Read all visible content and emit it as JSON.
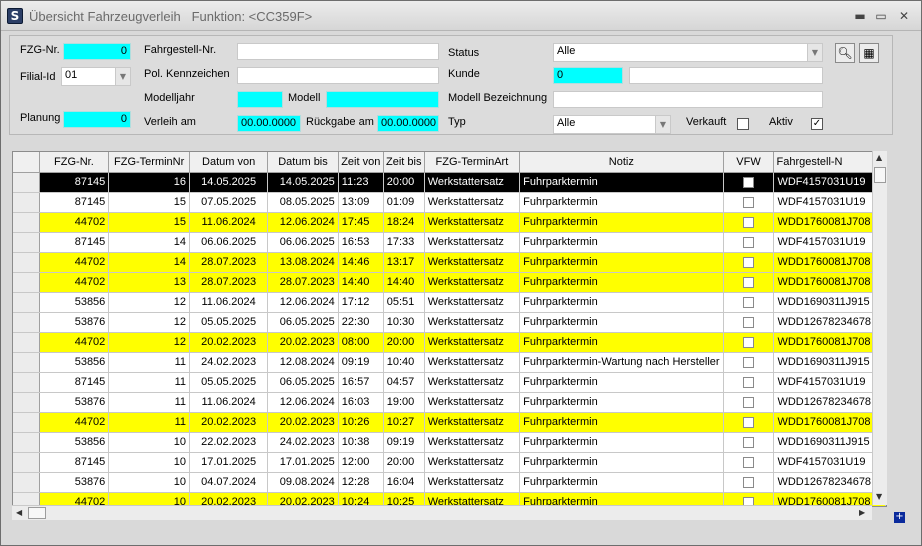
{
  "window": {
    "title": "Übersicht Fahrzeugverleih",
    "function_label": "Funktion: <CC359F>",
    "minimize": "▬",
    "maximize": "▭",
    "close": "✕"
  },
  "filters": {
    "fzg_nr": {
      "label": "FZG-Nr.",
      "value": "0"
    },
    "filial_id": {
      "label": "Filial-Id",
      "value": "01"
    },
    "planung": {
      "label": "Planung",
      "value": "0"
    },
    "fahrgestell_nr": {
      "label": "Fahrgestell-Nr.",
      "value": ""
    },
    "pol_kennzeichen": {
      "label": "Pol. Kennzeichen",
      "value": ""
    },
    "modelljahr": {
      "label": "Modelljahr",
      "value": ""
    },
    "modell": {
      "label": "Modell",
      "value": ""
    },
    "verleih_am": {
      "label": "Verleih am",
      "value": "00.00.0000"
    },
    "rueckgabe_am": {
      "label": "Rückgabe am",
      "value": "00.00.0000"
    },
    "status": {
      "label": "Status",
      "value": "Alle"
    },
    "kunde": {
      "label": "Kunde",
      "value": "0",
      "name_value": ""
    },
    "modell_bezeichnung": {
      "label": "Modell Bezeichnung",
      "value": ""
    },
    "typ": {
      "label": "Typ",
      "value": "Alle"
    },
    "verkauft": {
      "label": "Verkauft",
      "checked": false
    },
    "aktiv": {
      "label": "Aktiv",
      "checked": true
    }
  },
  "toolbar": {
    "search_icon": "search-icon",
    "calc_icon": "calculator-icon"
  },
  "grid": {
    "columns": [
      "FZG-Nr.",
      "FZG-TerminNr",
      "Datum von",
      "Datum bis",
      "Zeit von",
      "Zeit bis",
      "FZG-TerminArt",
      "Notiz",
      "VFW",
      "Fahrgestell-N"
    ],
    "rows": [
      {
        "fzg": "87145",
        "termin": "16",
        "von": "14.05.2025",
        "bis": "14.05.2025",
        "zvon": "11:23",
        "zbis": "20:00",
        "art": "Werkstattersatz",
        "notiz": "Fuhrparktermin",
        "fg": "WDF4157031U19",
        "style": "active"
      },
      {
        "fzg": "87145",
        "termin": "15",
        "von": "07.05.2025",
        "bis": "08.05.2025",
        "zvon": "13:09",
        "zbis": "01:09",
        "art": "Werkstattersatz",
        "notiz": "Fuhrparktermin",
        "fg": "WDF4157031U19",
        "style": ""
      },
      {
        "fzg": "44702",
        "termin": "15",
        "von": "11.06.2024",
        "bis": "12.06.2024",
        "zvon": "17:45",
        "zbis": "18:24",
        "art": "Werkstattersatz",
        "notiz": "Fuhrparktermin",
        "fg": "WDD1760081J708",
        "style": "hl"
      },
      {
        "fzg": "87145",
        "termin": "14",
        "von": "06.06.2025",
        "bis": "06.06.2025",
        "zvon": "16:53",
        "zbis": "17:33",
        "art": "Werkstattersatz",
        "notiz": "Fuhrparktermin",
        "fg": "WDF4157031U19",
        "style": ""
      },
      {
        "fzg": "44702",
        "termin": "14",
        "von": "28.07.2023",
        "bis": "13.08.2024",
        "zvon": "14:46",
        "zbis": "13:17",
        "art": "Werkstattersatz",
        "notiz": "Fuhrparktermin",
        "fg": "WDD1760081J708",
        "style": "hl"
      },
      {
        "fzg": "44702",
        "termin": "13",
        "von": "28.07.2023",
        "bis": "28.07.2023",
        "zvon": "14:40",
        "zbis": "14:40",
        "art": "Werkstattersatz",
        "notiz": "Fuhrparktermin",
        "fg": "WDD1760081J708",
        "style": "hl"
      },
      {
        "fzg": "53856",
        "termin": "12",
        "von": "11.06.2024",
        "bis": "12.06.2024",
        "zvon": "17:12",
        "zbis": "05:51",
        "art": "Werkstattersatz",
        "notiz": "Fuhrparktermin",
        "fg": "WDD1690311J915",
        "style": ""
      },
      {
        "fzg": "53876",
        "termin": "12",
        "von": "05.05.2025",
        "bis": "06.05.2025",
        "zvon": "22:30",
        "zbis": "10:30",
        "art": "Werkstattersatz",
        "notiz": "Fuhrparktermin",
        "fg": "WDD12678234678",
        "style": ""
      },
      {
        "fzg": "44702",
        "termin": "12",
        "von": "20.02.2023",
        "bis": "20.02.2023",
        "zvon": "08:00",
        "zbis": "20:00",
        "art": "Werkstattersatz",
        "notiz": "Fuhrparktermin",
        "fg": "WDD1760081J708",
        "style": "hl"
      },
      {
        "fzg": "53856",
        "termin": "11",
        "von": "24.02.2023",
        "bis": "12.08.2024",
        "zvon": "09:19",
        "zbis": "10:40",
        "art": "Werkstattersatz",
        "notiz": "Fuhrparktermin-Wartung nach Hersteller",
        "fg": "WDD1690311J915",
        "style": ""
      },
      {
        "fzg": "87145",
        "termin": "11",
        "von": "05.05.2025",
        "bis": "06.05.2025",
        "zvon": "16:57",
        "zbis": "04:57",
        "art": "Werkstattersatz",
        "notiz": "Fuhrparktermin",
        "fg": "WDF4157031U19",
        "style": ""
      },
      {
        "fzg": "53876",
        "termin": "11",
        "von": "11.06.2024",
        "bis": "12.06.2024",
        "zvon": "16:03",
        "zbis": "19:00",
        "art": "Werkstattersatz",
        "notiz": "Fuhrparktermin",
        "fg": "WDD12678234678",
        "style": ""
      },
      {
        "fzg": "44702",
        "termin": "11",
        "von": "20.02.2023",
        "bis": "20.02.2023",
        "zvon": "10:26",
        "zbis": "10:27",
        "art": "Werkstattersatz",
        "notiz": "Fuhrparktermin",
        "fg": "WDD1760081J708",
        "style": "hl"
      },
      {
        "fzg": "53856",
        "termin": "10",
        "von": "22.02.2023",
        "bis": "24.02.2023",
        "zvon": "10:38",
        "zbis": "09:19",
        "art": "Werkstattersatz",
        "notiz": "Fuhrparktermin",
        "fg": "WDD1690311J915",
        "style": ""
      },
      {
        "fzg": "87145",
        "termin": "10",
        "von": "17.01.2025",
        "bis": "17.01.2025",
        "zvon": "12:00",
        "zbis": "20:00",
        "art": "Werkstattersatz",
        "notiz": "Fuhrparktermin",
        "fg": "WDF4157031U19",
        "style": ""
      },
      {
        "fzg": "53876",
        "termin": "10",
        "von": "04.07.2024",
        "bis": "09.08.2024",
        "zvon": "12:28",
        "zbis": "16:04",
        "art": "Werkstattersatz",
        "notiz": "Fuhrparktermin",
        "fg": "WDD12678234678",
        "style": ""
      },
      {
        "fzg": "44702",
        "termin": "10",
        "von": "20.02.2023",
        "bis": "20.02.2023",
        "zvon": "10:24",
        "zbis": "10:25",
        "art": "Werkstattersatz",
        "notiz": "Fuhrparktermin",
        "fg": "WDD1760081J708",
        "style": "hl"
      }
    ]
  },
  "colors": {
    "highlight": "#ffff00",
    "cyan_field": "#00ffff",
    "selected_row": "#000000"
  }
}
